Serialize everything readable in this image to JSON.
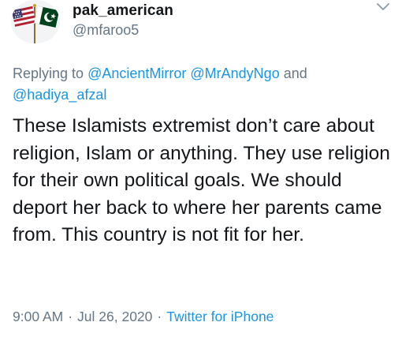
{
  "user": {
    "display_name": "pak_american",
    "handle": "@mfaroo5",
    "avatar_icon": "us-pakistan-flags-avatar"
  },
  "reply": {
    "prefix": "Replying to",
    "mentions": [
      "@AncientMirror",
      "@MrAndyNgo",
      "@hadiya_afzal"
    ],
    "and_word": "and"
  },
  "tweet": {
    "text": "These Islamists extremist don’t care about religion, Islam or anything. They use religion for their own political goals. We should deport her back to where her parents came from. This country is not fit for her."
  },
  "meta": {
    "time": "9:00 AM",
    "date": "Jul 26, 2020",
    "separator": "·",
    "source": "Twitter for iPhone"
  },
  "colors": {
    "text": "#14171a",
    "secondary": "#657786",
    "link": "#1b95e0",
    "flag_green": "#01411c",
    "flag_red": "#b22234",
    "flag_blue": "#3c3b6e"
  }
}
